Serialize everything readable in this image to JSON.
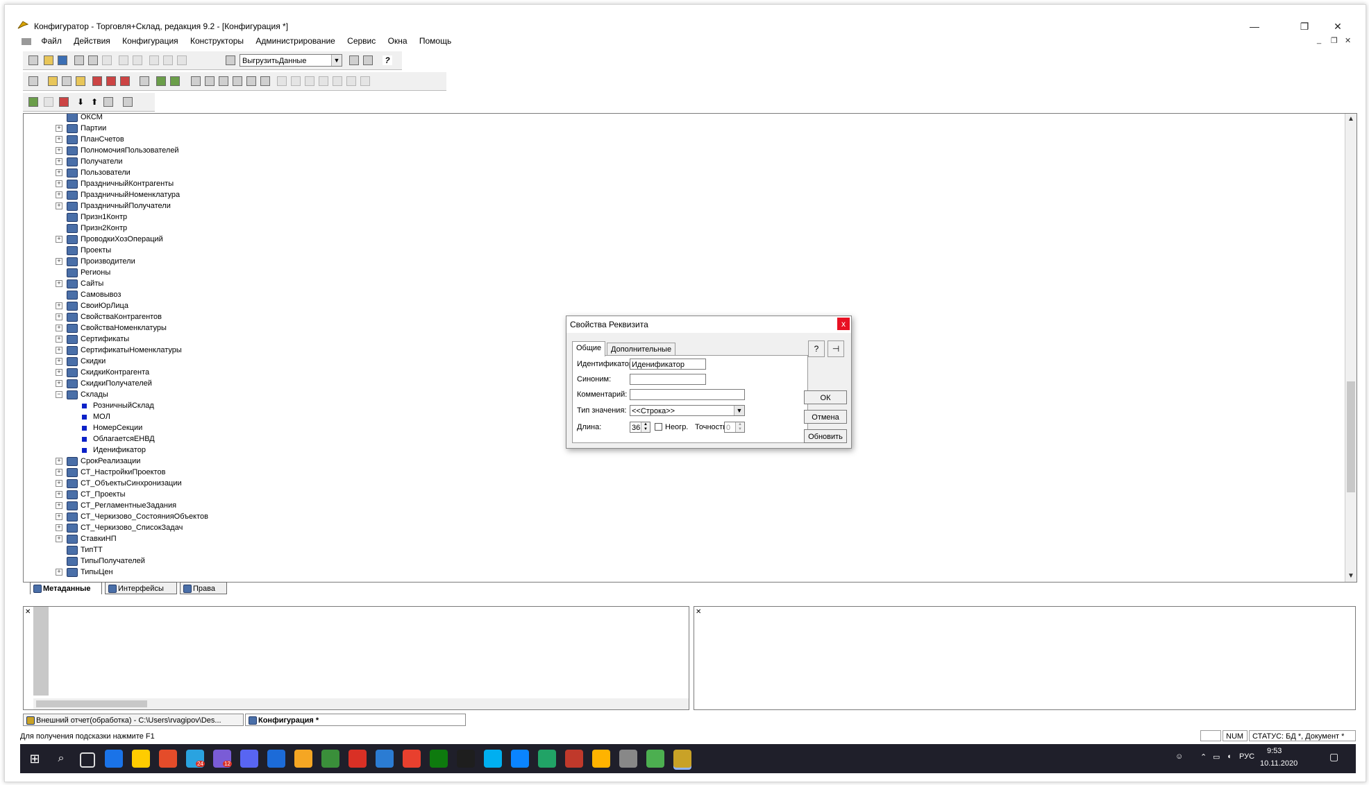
{
  "window": {
    "title": "Конфигуратор - Торговля+Склад, редакция 9.2 - [Конфигурация *]",
    "minimize_glyph": "—",
    "maximize_glyph": "❐",
    "close_glyph": "✕"
  },
  "menu": [
    "Файл",
    "Действия",
    "Конфигурация",
    "Конструкторы",
    "Администрирование",
    "Сервис",
    "Окна",
    "Помощь"
  ],
  "toolbar": {
    "combo_value": "ВыгрузитьДанные",
    "help_glyph": "?"
  },
  "tree": {
    "items": [
      {
        "label": "ОКСМ",
        "level": 0,
        "expand": ""
      },
      {
        "label": "Партии",
        "level": 0,
        "expand": "+"
      },
      {
        "label": "ПланСчетов",
        "level": 0,
        "expand": "+"
      },
      {
        "label": "ПолномочияПользователей",
        "level": 0,
        "expand": "+"
      },
      {
        "label": "Получатели",
        "level": 0,
        "expand": "+"
      },
      {
        "label": "Пользователи",
        "level": 0,
        "expand": "+"
      },
      {
        "label": "ПраздничныйКонтрагенты",
        "level": 0,
        "expand": "+"
      },
      {
        "label": "ПраздничныйНоменклатура",
        "level": 0,
        "expand": "+"
      },
      {
        "label": "ПраздничныйПолучатели",
        "level": 0,
        "expand": "+"
      },
      {
        "label": "Призн1Контр",
        "level": 0,
        "expand": ""
      },
      {
        "label": "Призн2Контр",
        "level": 0,
        "expand": ""
      },
      {
        "label": "ПроводкиХозОпераций",
        "level": 0,
        "expand": "+"
      },
      {
        "label": "Проекты",
        "level": 0,
        "expand": ""
      },
      {
        "label": "Производители",
        "level": 0,
        "expand": "+"
      },
      {
        "label": "Регионы",
        "level": 0,
        "expand": ""
      },
      {
        "label": "Сайты",
        "level": 0,
        "expand": "+"
      },
      {
        "label": "Самовывоз",
        "level": 0,
        "expand": ""
      },
      {
        "label": "СвоиЮрЛица",
        "level": 0,
        "expand": "+"
      },
      {
        "label": "СвойстваКонтрагентов",
        "level": 0,
        "expand": "+"
      },
      {
        "label": "СвойстваНоменклатуры",
        "level": 0,
        "expand": "+"
      },
      {
        "label": "Сертификаты",
        "level": 0,
        "expand": "+"
      },
      {
        "label": "СертификатыНоменклатуры",
        "level": 0,
        "expand": "+"
      },
      {
        "label": "Скидки",
        "level": 0,
        "expand": "+"
      },
      {
        "label": "СкидкиКонтрагента",
        "level": 0,
        "expand": "+"
      },
      {
        "label": "СкидкиПолучателей",
        "level": 0,
        "expand": "+"
      },
      {
        "label": "Склады",
        "level": 0,
        "expand": "−"
      },
      {
        "label": "РозничныйСклад",
        "level": 1,
        "expand": ""
      },
      {
        "label": "МОЛ",
        "level": 1,
        "expand": ""
      },
      {
        "label": "НомерСекции",
        "level": 1,
        "expand": ""
      },
      {
        "label": "ОблагаетсяЕНВД",
        "level": 1,
        "expand": ""
      },
      {
        "label": "Иденификатор",
        "level": 1,
        "expand": ""
      },
      {
        "label": "СрокРеализации",
        "level": 0,
        "expand": "+"
      },
      {
        "label": "СТ_НастройкиПроектов",
        "level": 0,
        "expand": "+"
      },
      {
        "label": "СТ_ОбъектыСинхронизации",
        "level": 0,
        "expand": "+"
      },
      {
        "label": "СТ_Проекты",
        "level": 0,
        "expand": "+"
      },
      {
        "label": "СТ_РегламентныеЗадания",
        "level": 0,
        "expand": "+"
      },
      {
        "label": "СТ_Черкизово_СостоянияОбъектов",
        "level": 0,
        "expand": "+"
      },
      {
        "label": "СТ_Черкизово_СписокЗадач",
        "level": 0,
        "expand": "+"
      },
      {
        "label": "СтавкиНП",
        "level": 0,
        "expand": "+"
      },
      {
        "label": "ТипТТ",
        "level": 0,
        "expand": ""
      },
      {
        "label": "ТипыПолучателей",
        "level": 0,
        "expand": ""
      },
      {
        "label": "ТипыЦен",
        "level": 0,
        "expand": "+"
      }
    ]
  },
  "bottom_tabs": [
    "Метаданные",
    "Интерфейсы",
    "Права"
  ],
  "dialog": {
    "title": "Свойства Реквизита",
    "close_glyph": "x",
    "tabs": [
      "Общие",
      "Дополнительные"
    ],
    "fields": {
      "identifier_label": "Идентификатор:",
      "identifier_value": "Иденификатор",
      "synonym_label": "Синоним:",
      "synonym_value": "",
      "comment_label": "Комментарий:",
      "comment_value": "",
      "type_label": "Тип значения:",
      "type_value": "<<Строка>>",
      "length_label": "Длина:",
      "length_value": "36",
      "unlimited_label": "Неогр.",
      "precision_label": "Точность:",
      "precision_value": "0"
    },
    "buttons": {
      "ok": "ОК",
      "cancel": "Отмена",
      "refresh": "Обновить"
    },
    "help_glyph": "?",
    "pin_glyph": "⊣"
  },
  "mdi_tabs": [
    "Внешний отчет(обработка) - C:\\Users\\rvagipov\\Des...",
    "Конфигурация *"
  ],
  "status": {
    "hint": "Для получения подсказки нажмите F1",
    "num": "NUM",
    "db_status": "СТАТУС: БД *, Документ *"
  },
  "taskbar": {
    "lang": "РУС",
    "time": "9:53",
    "date": "10.11.2020",
    "badge_telegram": "24",
    "badge_viber": "12",
    "colors": [
      "#1a73e8",
      "#ffcc00",
      "#e44c2a",
      "#2aa3e0",
      "#7a5cd6",
      "#5865f2",
      "#1c6bd8",
      "#f5a623",
      "#3a8f3a",
      "#d93025",
      "#2b7cd3",
      "#e8402e",
      "#0e7a0e",
      "#1e1e1e",
      "#00aff0",
      "#0a84ff",
      "#21a366",
      "#c0392b",
      "#ffb300",
      "#888888",
      "#4caf50",
      "#c9a227"
    ]
  }
}
